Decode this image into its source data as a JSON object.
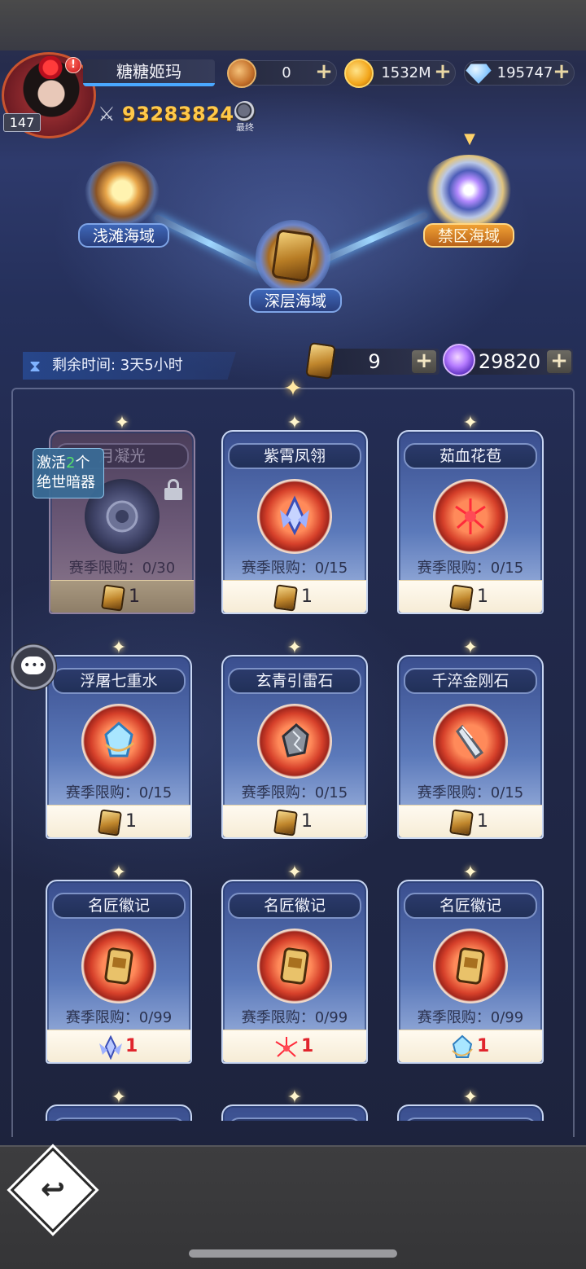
{
  "player": {
    "name": "糖糖姬玛",
    "level": "147",
    "power": "93283824",
    "rank_label": "最终"
  },
  "currencies": [
    {
      "icon": "token-icon",
      "value": "0"
    },
    {
      "icon": "gold-coin-icon",
      "value": "1532M"
    },
    {
      "icon": "diamond-icon",
      "value": "195747"
    }
  ],
  "map": {
    "nodes": [
      {
        "label": "浅滩海域",
        "selected": false
      },
      {
        "label": "深层海域",
        "selected": false
      },
      {
        "label": "禁区海域",
        "selected": true
      }
    ]
  },
  "timer": {
    "label": "剩余时间: 3天5小时"
  },
  "resources": [
    {
      "icon": "master-badge-icon",
      "value": "9"
    },
    {
      "icon": "purple-shell-icon",
      "value": "29820"
    }
  ],
  "tooltip": {
    "line1_prefix": "激活",
    "line1_count": "2",
    "line1_suffix": "个",
    "line2": "绝世暗器"
  },
  "shop": {
    "items": [
      {
        "name": "月凝光",
        "limit": "赛季限购：0/30",
        "price": "1",
        "currency": "master-badge-icon",
        "locked": true
      },
      {
        "name": "紫霄凤翎",
        "limit": "赛季限购：0/15",
        "price": "1",
        "currency": "master-badge-icon",
        "locked": false
      },
      {
        "name": "茹血花苞",
        "limit": "赛季限购：0/15",
        "price": "1",
        "currency": "master-badge-icon",
        "locked": false
      },
      {
        "name": "浮屠七重水",
        "limit": "赛季限购：0/15",
        "price": "1",
        "currency": "master-badge-icon",
        "locked": false
      },
      {
        "name": "玄青引雷石",
        "limit": "赛季限购：0/15",
        "price": "1",
        "currency": "master-badge-icon",
        "locked": false
      },
      {
        "name": "千淬金刚石",
        "limit": "赛季限购：0/15",
        "price": "1",
        "currency": "master-badge-icon",
        "locked": false
      },
      {
        "name": "名匠徽记",
        "limit": "赛季限购：0/99",
        "price": "1",
        "currency": "violet-feather-icon",
        "locked": false
      },
      {
        "name": "名匠徽记",
        "limit": "赛季限购：0/99",
        "price": "1",
        "currency": "red-flower-icon",
        "locked": false
      },
      {
        "name": "名匠徽记",
        "limit": "赛季限购：0/99",
        "price": "1",
        "currency": "water-crystal-icon",
        "locked": false
      }
    ]
  },
  "colors": {
    "gold": "#ffc94a",
    "accent_blue": "#4aa8ff",
    "price_red": "#e0242c",
    "highlight_green": "#55e06a"
  }
}
